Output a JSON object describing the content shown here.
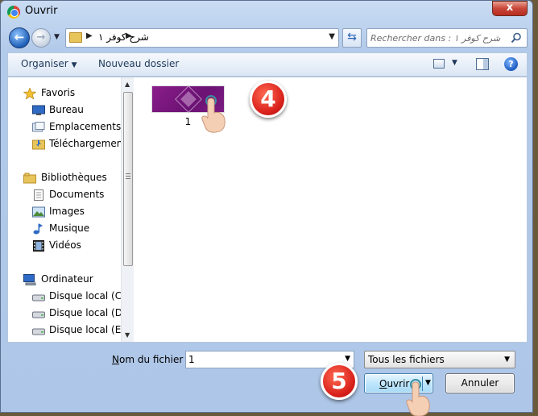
{
  "window": {
    "title": "Ouvrir",
    "close_label": "x"
  },
  "address": {
    "back_label": "←",
    "forward_label": "→",
    "path_current": "شرح كوفر ١",
    "search_placeholder": "Rechercher dans : شرح كوفر ١"
  },
  "toolbar": {
    "organise_label": "Organiser",
    "new_folder_label": "Nouveau dossier"
  },
  "sidebar": {
    "favorites": {
      "label": "Favoris",
      "items": [
        "Bureau",
        "Emplacements ré",
        "Téléchargements"
      ]
    },
    "libraries": {
      "label": "Bibliothèques",
      "items": [
        "Documents",
        "Images",
        "Musique",
        "Vidéos"
      ]
    },
    "computer": {
      "label": "Ordinateur",
      "items": [
        "Disque local (C:)",
        "Disque local (D:)",
        "Disque local (E:)"
      ]
    }
  },
  "files": [
    {
      "name": "1"
    }
  ],
  "footer": {
    "filename_label_accel": "N",
    "filename_label_rest": "om du fichier :",
    "filename_value": "1",
    "filter_value": "Tous les fichiers",
    "open_label_accel": "O",
    "open_label_rest": "uvrir",
    "cancel_label": "Annuler"
  },
  "annotations": {
    "step_open_file": "4",
    "step_click_open": "5"
  },
  "colors": {
    "thumbnail_purple": "#7b1c82",
    "badge_red": "#d8201b",
    "accent_blue": "#1f5fb7"
  }
}
